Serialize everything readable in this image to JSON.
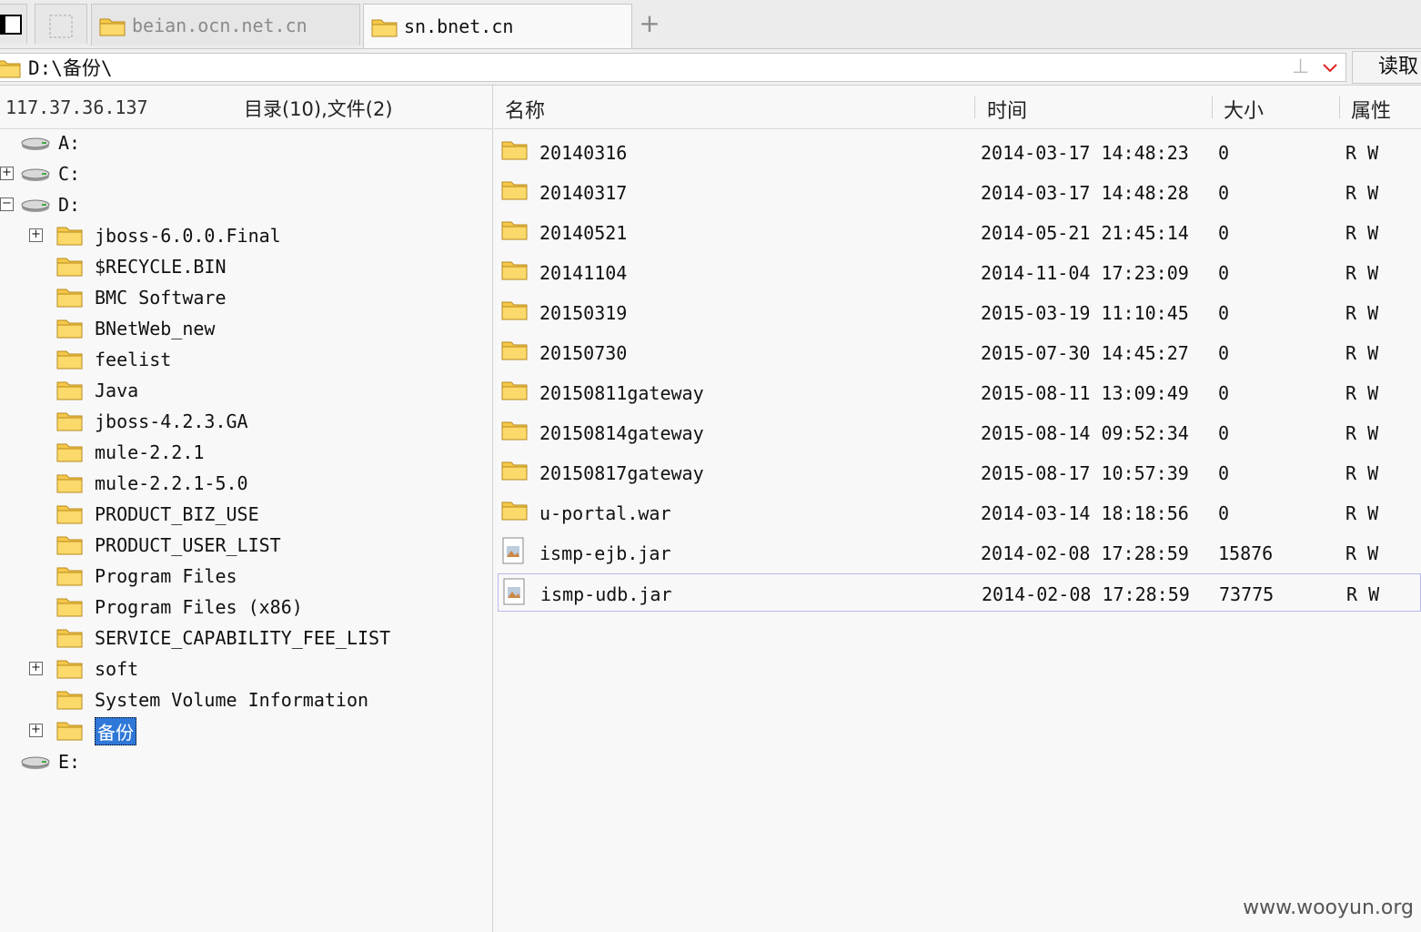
{
  "tabs": {
    "first_tab_label": "",
    "items": [
      {
        "label": "beian.ocn.net.cn",
        "active": false
      },
      {
        "label": "sn.bnet.cn",
        "active": true
      }
    ],
    "add_label": "+"
  },
  "address": {
    "path": "D:\\备份\\",
    "up_icon": "up-arrow-icon",
    "read_button": "读取"
  },
  "left": {
    "ip": "117.37.36.137",
    "counts": "目录(10),文件(2)",
    "tree": [
      {
        "label": "A:",
        "kind": "drive",
        "expander": ""
      },
      {
        "label": "C:",
        "kind": "drive",
        "expander": "+"
      },
      {
        "label": "D:",
        "kind": "drive",
        "expander": "−"
      },
      {
        "label": "jboss-6.0.0.Final",
        "kind": "folder",
        "expander": "+"
      },
      {
        "label": "$RECYCLE.BIN",
        "kind": "folder",
        "expander": ""
      },
      {
        "label": "BMC Software",
        "kind": "folder",
        "expander": ""
      },
      {
        "label": "BNetWeb_new",
        "kind": "folder",
        "expander": ""
      },
      {
        "label": "feelist",
        "kind": "folder",
        "expander": ""
      },
      {
        "label": "Java",
        "kind": "folder",
        "expander": ""
      },
      {
        "label": "jboss-4.2.3.GA",
        "kind": "folder",
        "expander": ""
      },
      {
        "label": "mule-2.2.1",
        "kind": "folder",
        "expander": ""
      },
      {
        "label": "mule-2.2.1-5.0",
        "kind": "folder",
        "expander": ""
      },
      {
        "label": "PRODUCT_BIZ_USE",
        "kind": "folder",
        "expander": ""
      },
      {
        "label": "PRODUCT_USER_LIST",
        "kind": "folder",
        "expander": ""
      },
      {
        "label": "Program Files",
        "kind": "folder",
        "expander": ""
      },
      {
        "label": "Program Files (x86)",
        "kind": "folder",
        "expander": ""
      },
      {
        "label": "SERVICE_CAPABILITY_FEE_LIST",
        "kind": "folder",
        "expander": ""
      },
      {
        "label": "soft",
        "kind": "folder",
        "expander": "+"
      },
      {
        "label": "System Volume Information",
        "kind": "folder",
        "expander": ""
      },
      {
        "label": "备份",
        "kind": "folder",
        "expander": "+",
        "selected": true
      },
      {
        "label": "E:",
        "kind": "drive",
        "expander": ""
      }
    ]
  },
  "list": {
    "columns": {
      "name": "名称",
      "time": "时间",
      "size": "大小",
      "attr": "属性"
    },
    "rows": [
      {
        "name": "20140316",
        "time": "2014-03-17 14:48:23",
        "size": "0",
        "attr": "R W",
        "type": "folder"
      },
      {
        "name": "20140317",
        "time": "2014-03-17 14:48:28",
        "size": "0",
        "attr": "R W",
        "type": "folder"
      },
      {
        "name": "20140521",
        "time": "2014-05-21 21:45:14",
        "size": "0",
        "attr": "R W",
        "type": "folder"
      },
      {
        "name": "20141104",
        "time": "2014-11-04 17:23:09",
        "size": "0",
        "attr": "R W",
        "type": "folder"
      },
      {
        "name": "20150319",
        "time": "2015-03-19 11:10:45",
        "size": "0",
        "attr": "R W",
        "type": "folder"
      },
      {
        "name": "20150730",
        "time": "2015-07-30 14:45:27",
        "size": "0",
        "attr": "R W",
        "type": "folder"
      },
      {
        "name": "20150811gateway",
        "time": "2015-08-11 13:09:49",
        "size": "0",
        "attr": "R W",
        "type": "folder"
      },
      {
        "name": "20150814gateway",
        "time": "2015-08-14 09:52:34",
        "size": "0",
        "attr": "R W",
        "type": "folder"
      },
      {
        "name": "20150817gateway",
        "time": "2015-08-17 10:57:39",
        "size": "0",
        "attr": "R W",
        "type": "folder"
      },
      {
        "name": "u-portal.war",
        "time": "2014-03-14 18:18:56",
        "size": "0",
        "attr": "R W",
        "type": "folder"
      },
      {
        "name": "ismp-ejb.jar",
        "time": "2014-02-08 17:28:59",
        "size": "15876",
        "attr": "R W",
        "type": "file"
      },
      {
        "name": "ismp-udb.jar",
        "time": "2014-02-08 17:28:59",
        "size": "73775",
        "attr": "R W",
        "type": "file",
        "focused": true
      }
    ]
  },
  "watermark": "www.wooyun.org",
  "colors": {
    "folder": "#f5c84a",
    "selection": "#2f78d8"
  }
}
